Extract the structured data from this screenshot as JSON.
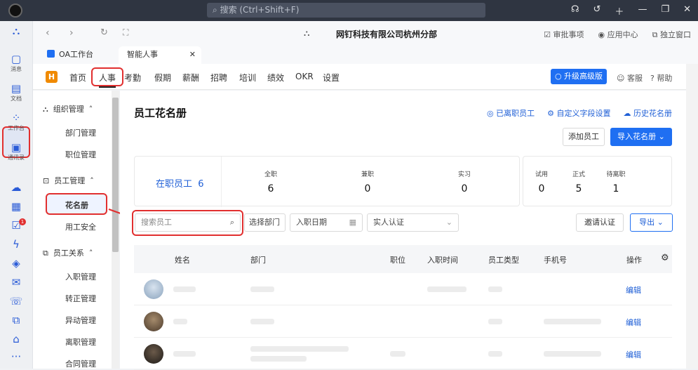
{
  "titlebar": {
    "search_placeholder": "搜索 (Ctrl+Shift+F)"
  },
  "rail": {
    "items": [
      {
        "label": "消息",
        "icon": "chat-icon"
      },
      {
        "label": "文档",
        "icon": "doc-icon"
      },
      {
        "label": "工作台",
        "icon": "grid-icon"
      },
      {
        "label": "通讯录",
        "icon": "contacts-icon"
      }
    ],
    "badge": "1",
    "more": "···"
  },
  "navbar": {
    "company": "网钉科技有限公司杭州分部",
    "approval": "审批事项",
    "app_center": "应用中心",
    "standalone": "独立窗口"
  },
  "tabs": [
    {
      "label": "OA工作台"
    },
    {
      "label": "智能人事"
    }
  ],
  "appbar": {
    "logo": "H",
    "menu": [
      "首页",
      "人事",
      "考勤",
      "假期",
      "薪酬",
      "招聘",
      "培训",
      "绩效",
      "OKR",
      "设置"
    ],
    "upgrade": "升级高级版",
    "service": "客服",
    "help": "帮助"
  },
  "sidebar": {
    "groups": [
      {
        "title": "组织管理",
        "items": [
          "部门管理",
          "职位管理"
        ]
      },
      {
        "title": "员工管理",
        "items": [
          "花名册",
          "用工安全"
        ]
      },
      {
        "title": "员工关系",
        "items": [
          "入职管理",
          "转正管理",
          "异动管理",
          "离职管理",
          "合同管理"
        ]
      }
    ]
  },
  "main": {
    "title": "员工花名册",
    "links": [
      "已离职员工",
      "自定义字段设置",
      "历史花名册"
    ],
    "add_employee": "添加员工",
    "import_roster": "导入花名册",
    "stats": {
      "active_label": "在职员工",
      "active_count": "6",
      "groups1": [
        {
          "label": "全职",
          "value": "6"
        },
        {
          "label": "兼职",
          "value": "0"
        },
        {
          "label": "实习",
          "value": "0"
        }
      ],
      "groups2": [
        {
          "label": "试用",
          "value": "0"
        },
        {
          "label": "正式",
          "value": "5"
        },
        {
          "label": "待离职",
          "value": "1"
        }
      ]
    },
    "filters": {
      "search_placeholder": "搜索员工",
      "dept": "选择部门",
      "date": "入职日期",
      "verify": "实人认证",
      "invite": "邀请认证",
      "export": "导出"
    },
    "table": {
      "headers": [
        "姓名",
        "部门",
        "职位",
        "入职时间",
        "员工类型",
        "手机号",
        "操作"
      ],
      "edit": "编辑"
    }
  },
  "colors": {
    "accent": "#1f6ff2",
    "highlight": "#e12f2f",
    "titlebar": "#2f3541"
  }
}
